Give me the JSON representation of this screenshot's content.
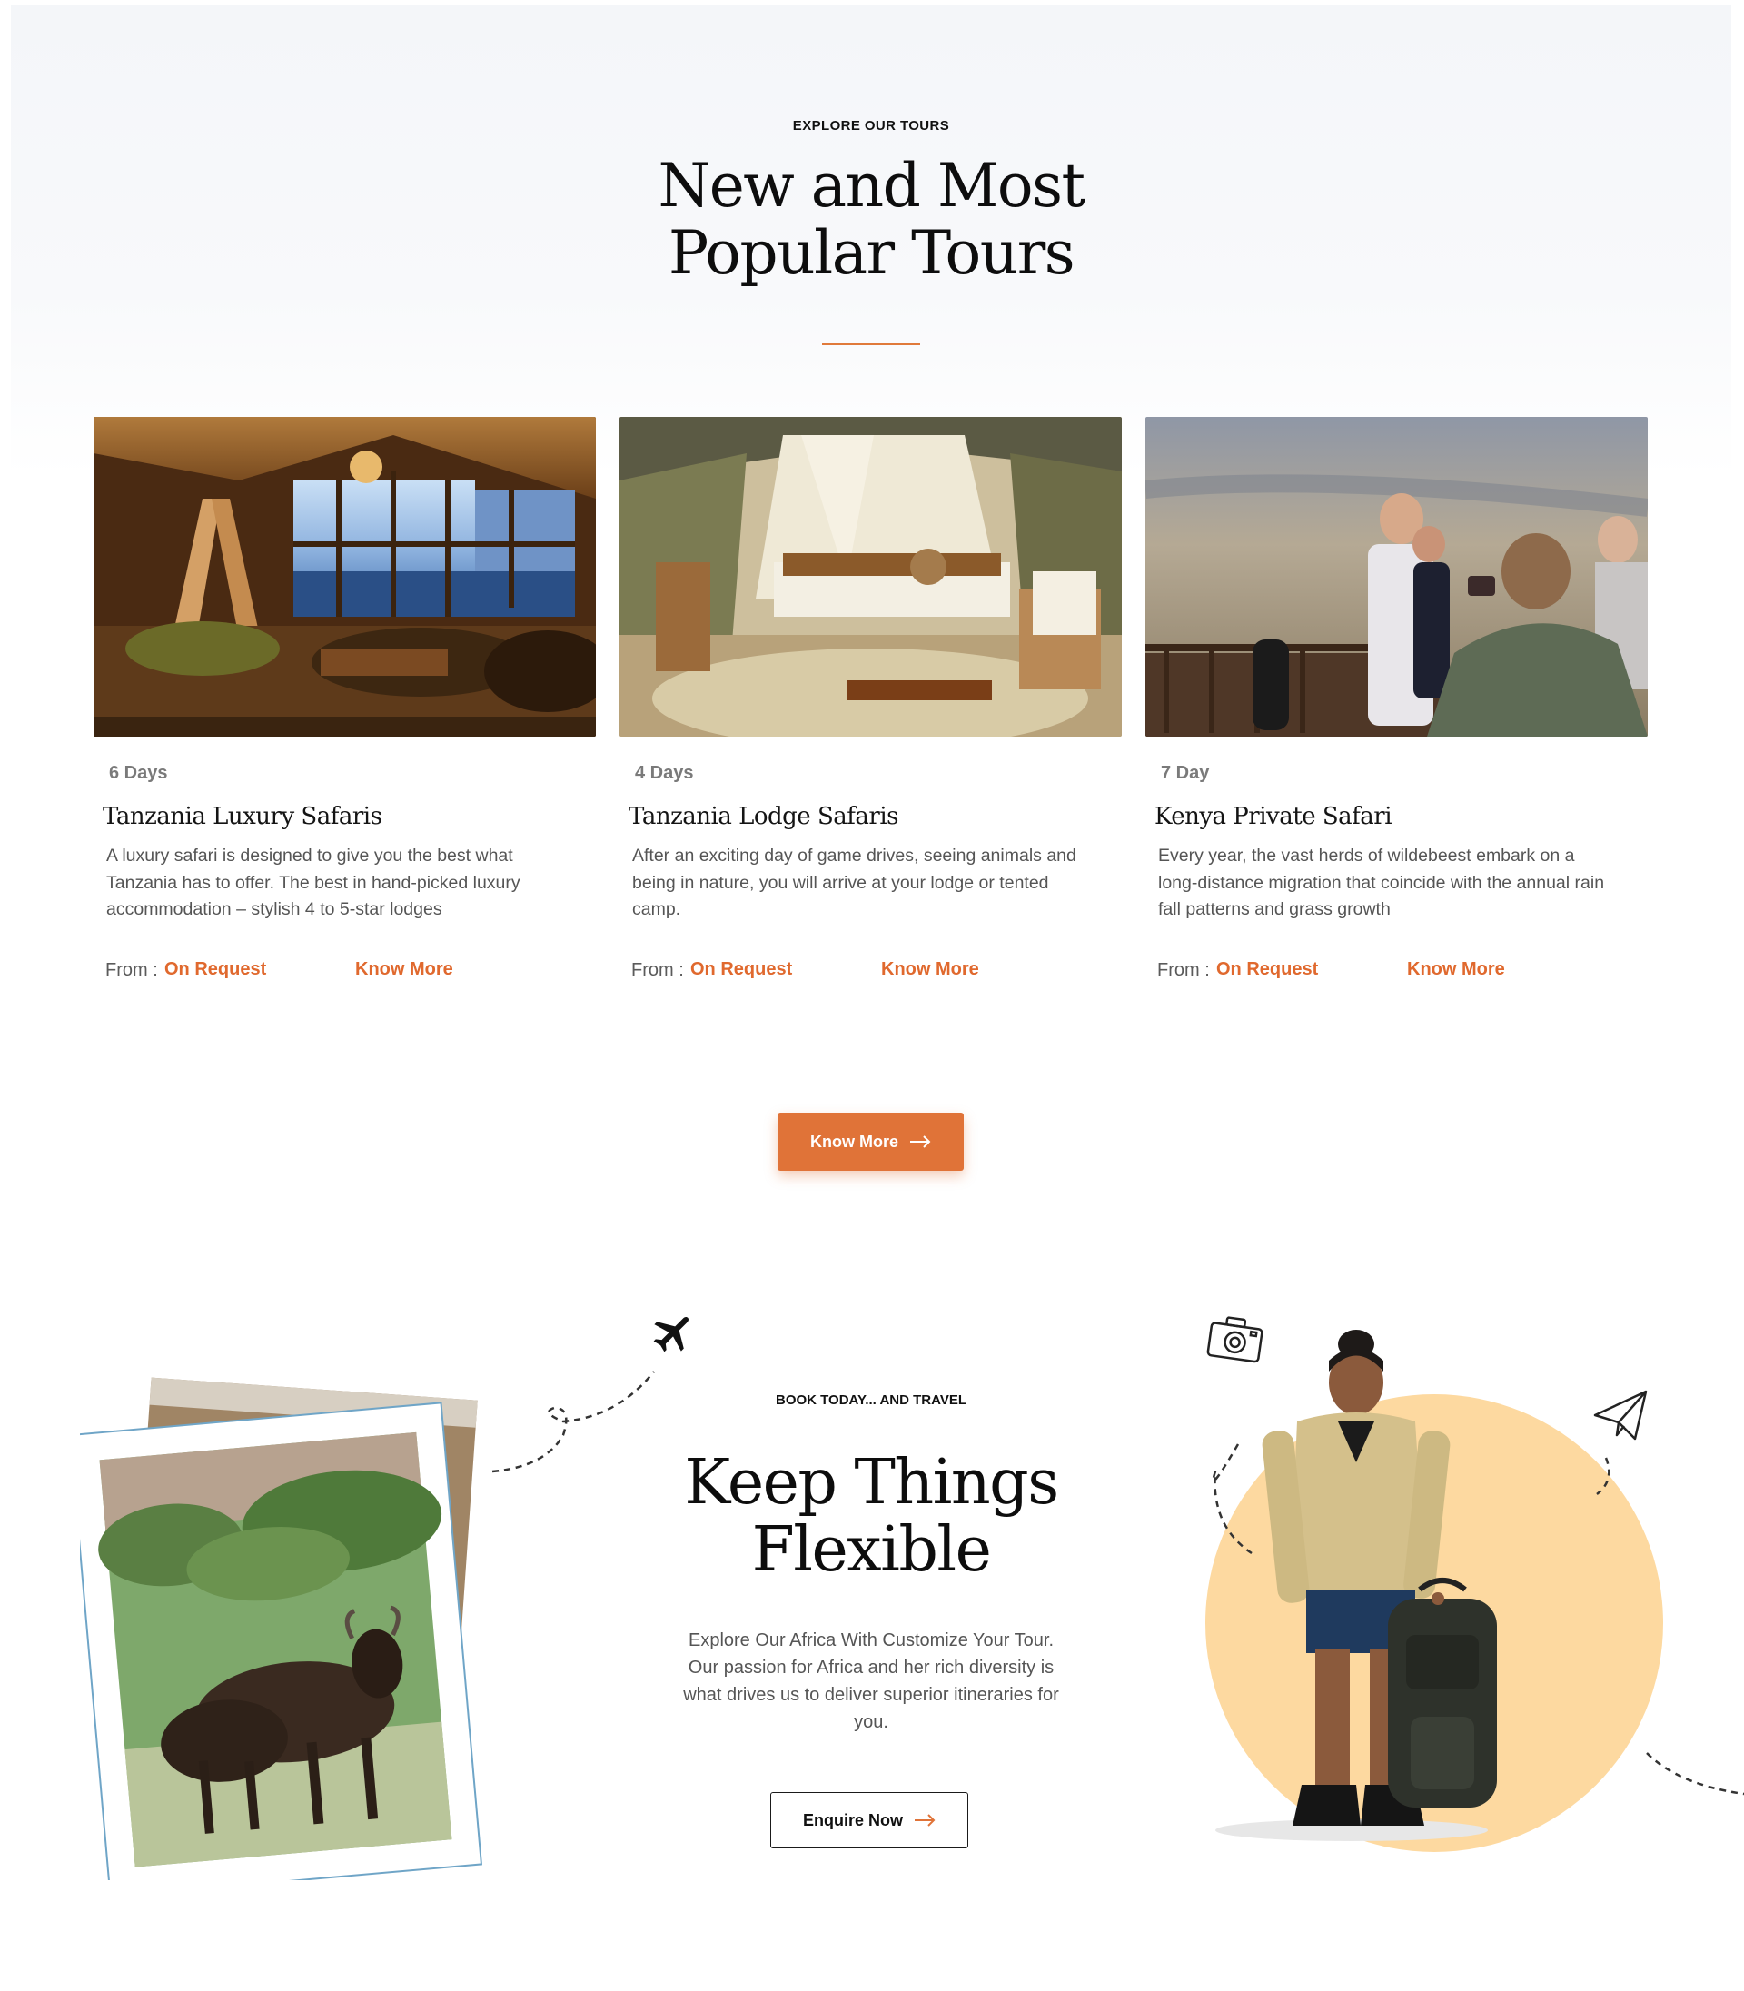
{
  "tours": {
    "eyebrow": "EXPLORE OUR TOURS",
    "title_line1": "New and Most",
    "title_line2": "Popular Tours",
    "accent_color": "#e07338",
    "cards": [
      {
        "duration": "6 Days",
        "title": "Tanzania Luxury Safaris",
        "description": "A luxury safari is designed to give you the best what Tanzania has to offer. The best in hand-picked luxury accommodation – stylish 4 to 5-star lodges",
        "from_label": "From :",
        "price": "On Request",
        "link": "Know More"
      },
      {
        "duration": "4 Days",
        "title": "Tanzania Lodge Safaris",
        "description": "After an exciting day of game drives, seeing animals and being in nature, you will arrive at your lodge or tented camp.",
        "from_label": "From :",
        "price": "On Request",
        "link": "Know More"
      },
      {
        "duration": "7 Day",
        "title": "Kenya Private Safari",
        "description": "Every year, the vast herds of wildebeest embark on a long-distance migration that coincide with the annual rain fall patterns and grass growth",
        "from_label": "From :",
        "price": "On Request",
        "link": "Know More"
      }
    ],
    "button_label": "Know More"
  },
  "booking": {
    "eyebrow": "BOOK TODAY... AND TRAVEL",
    "title_line1": "Keep Things",
    "title_line2": "Flexible",
    "body": "Explore Our Africa With Customize Your Tour. Our passion for Africa and her rich diversity is what drives us to deliver superior itineraries for you.",
    "button_label": "Enquire Now",
    "circle_color": "#fdd9a0"
  },
  "icons": [
    "arrow-right-icon",
    "airplane-icon",
    "camera-icon",
    "paper-plane-icon"
  ]
}
